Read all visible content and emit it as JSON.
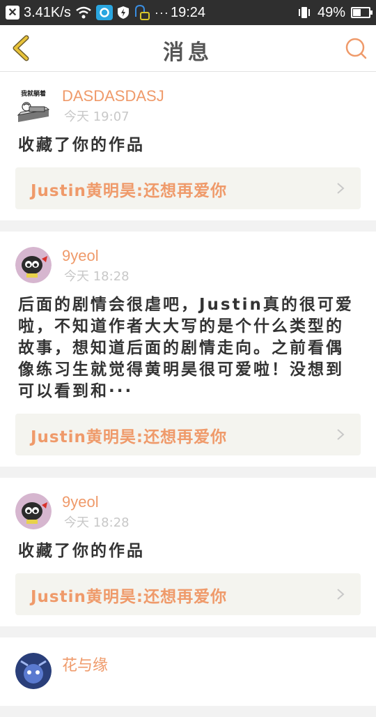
{
  "status_bar": {
    "speed": "3.41K/s",
    "time": "19:24",
    "battery": "49%",
    "battery_level": 0.49,
    "icons": [
      "close-notification-icon",
      "wifi-icon",
      "app-notification-icon",
      "shield-icon",
      "bluetooth-icon",
      "more-dots-icon",
      "vibrate-icon",
      "battery-icon"
    ]
  },
  "nav": {
    "title": "消息",
    "back_icon": "chevron-left-icon",
    "search_icon": "search-icon",
    "accent": "#e8c33a"
  },
  "colors": {
    "accent": "#ef9a6a",
    "card_link_bg": "#f4f4ef",
    "timestamp": "#c8c8c8"
  },
  "messages": [
    {
      "user": "DASDASDASJ",
      "avatar_caption": "我就躺着",
      "time": "今天 19:07",
      "text": "收藏了你的作品",
      "work": "Justin黄明昊:还想再爱你"
    },
    {
      "user": "9yeol",
      "time": "今天 18:28",
      "text": "后面的剧情会很虐吧，Justin真的很可爱啦，不知道作者大大写的是个什么类型的故事，想知道后面的剧情走向。之前看偶像练习生就觉得黄明昊很可爱啦！没想到可以看到和···",
      "work": "Justin黄明昊:还想再爱你"
    },
    {
      "user": "9yeol",
      "time": "今天 18:28",
      "text": "收藏了你的作品",
      "work": "Justin黄明昊:还想再爱你"
    },
    {
      "user": "花与缘",
      "time": "",
      "text": "",
      "work": ""
    }
  ]
}
